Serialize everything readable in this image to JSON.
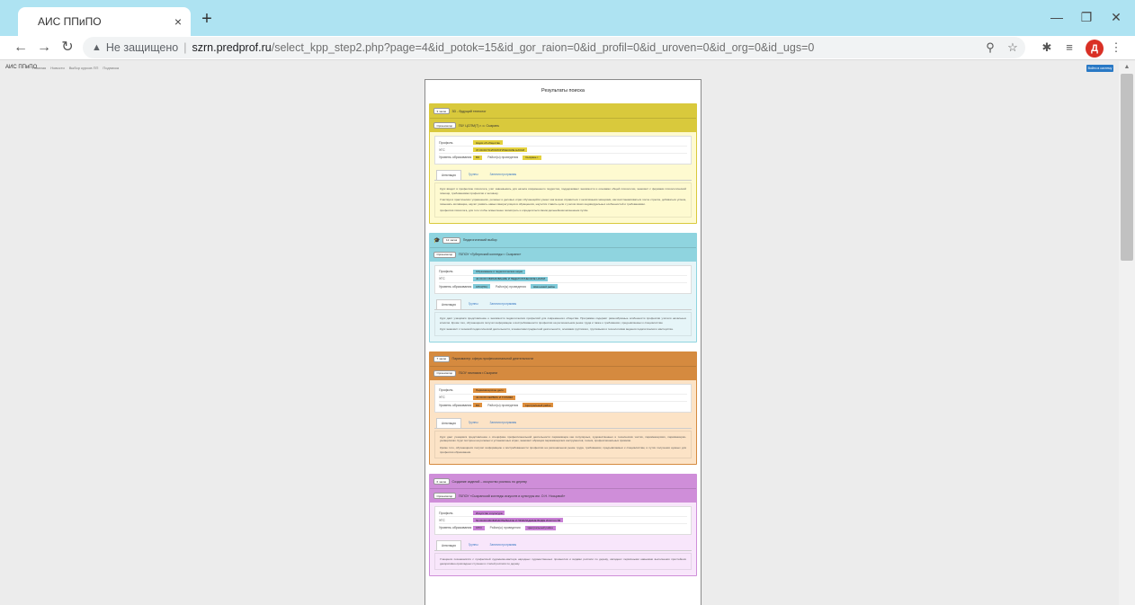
{
  "browser": {
    "tab_title": "АИС ППиПО",
    "tab_close": "×",
    "new_tab": "+",
    "address_warning": "Не защищено",
    "address_host": "szrn.predprof.ru",
    "address_path": "/select_kpp_step2.php?page=4&id_potok=15&id_gor_raion=0&id_profil=0&id_uroven=0&id_org=0&id_ugs=0",
    "avatar_letter": "Д",
    "icons": [
      "back-arrow-icon",
      "forward-arrow-icon",
      "reload-icon",
      "warning-icon",
      "zoom-icon",
      "star-icon",
      "extensions-icon",
      "playlist-icon",
      "menu-icon"
    ]
  },
  "site": {
    "brand": "АИС ППиПО",
    "nav": [
      "Главная",
      "Новости",
      "Выбор курсов ПП",
      "Подписка"
    ],
    "login_label": "Войти в систему"
  },
  "results": {
    "title": "Результаты поиска",
    "labels": {
      "profile": "Профиль",
      "ugs": "УГС",
      "level": "Уровень образования",
      "place": "Район(ы) проведения"
    },
    "tabs": [
      "Аннотация",
      "Группы",
      "Занятия программы"
    ],
    "org_badge": "Организатор",
    "cards": [
      {
        "badge": "3 часов",
        "title": "3D - будущий технолог",
        "org": "ГБУ ЦСПМ(Т) г. о. Сызрань",
        "profile": "Науки об обществе",
        "ugs": "37.00.00 ПСИХОЛОГИЧЕСКИЕ НАУКИ",
        "level": "ВО",
        "place": "Сызрань г.",
        "desc": [
          "Курс вводит в профессию психолога, учит завоевывать для начала современного подростка, поддерживает значимости и основами общей психологии, знакомит с формами психологической помощи, требованиями профессии к человеку.",
          "Участвуя в практических упражнениях, ролевых и деловых играх обучающийся узнает как можно справиться с негативными эмоциями, как восстанавливаться после стресса, добиваться успеха, повышать мотивацию, научит развить навык саморегуляции в обращениях, научится ставить цели с учетом своих индивидуальных особенностей и требованиями.",
          "профессия психолога, для того чтобы осмысленно посмотреть и определиться своим дальнейшим жизненным путём."
        ]
      },
      {
        "badge": "12 часов",
        "title": "Педагогический выбор",
        "org": "ГБПОУ «Губернский колледж г. Сызрани»",
        "profile": "Образование и педагогические науки",
        "ugs": "44.00.00 ОБРАЗОВАНИЕ И ПЕДАГОГИЧЕСКИЕ НАУКИ",
        "level": "СПО(ПС)",
        "place": "Шигонский район",
        "desc": [
          "Курс даёт учащимся представление о значимости педагогических профессий для современного общества. Программа содержит разнообразные особенности профессии учителя начальных классов. Кроме того, обучающиеся получат информацию о востребованности профессии на региональном рынке труда и также о требованиях, предъявляемых к специалистам.",
          "Курс знакомит с техникой педагогической деятельности, элементами предметной деятельности, основами группового, групповыми и технологиями ведения педагогического мастерства."
        ]
      },
      {
        "badge": "7 часов",
        "title": "Парикмахер: сфера профессиональной деятельности",
        "org": "ГБОУ гимназия г.Сызрани",
        "profile": "Парикмахерское дело",
        "ugs": "43.00.00 СЕРВИС И ТУРИЗМ",
        "level": "ВО",
        "place": "Центральный район",
        "desc": [
          "Курс дает учащимся представление о специфике профессиональной деятельности парикмахера как популярных, художественных и технических частях, парикмахерских, парикмахерах-универсалах. Курс построен на ролевых и установочных играх, знакомит образцов парикмахерских инструментов, техник, профессиональных приёмов.",
          "Кроме того, обучающиеся получат информацию о востребованности профессии на региональном рынке труда, требованиях, предъявляемых к специалистам, и путях получения нужных для профессии образования."
        ]
      },
      {
        "badge": "6 часов",
        "title": "Создание изделий – искусство роспись по дереву",
        "org": "ГБПОУ «Сызранский колледж искусств и культуры им. О.Н. Носцовой»",
        "profile": "Искусство и культура",
        "ugs": "54.00.00 ИЗОБРАЗИТЕЛЬНОЕ И ПРИКЛАДНЫЕ ВИДЫ ИСКУССТВ",
        "level": "СПО",
        "place": "Центральный район",
        "desc": [
          "Учащиеся познакомятся с профессией художника-мастера народных художественных промыслов и видами росписи по дереву, овладеют первичными навыками выполнения простейших декоративно-прикладных ступенек и стилей росписи по дереву."
        ]
      }
    ]
  },
  "colors": {
    "card1_head": "#d9c93c",
    "card1_body": "#fefad0",
    "card1_chip": "#e4d13d",
    "card2_head": "#8fd4df",
    "card2_body": "#e6f5f8",
    "card2_chip": "#7fcad9",
    "card3_head": "#d58a3f",
    "card3_body": "#fce3c6",
    "card3_chip": "#de8f3d",
    "card4_head": "#cf8ed9",
    "card4_body": "#f8e6fb",
    "card4_chip": "#c981d6"
  }
}
